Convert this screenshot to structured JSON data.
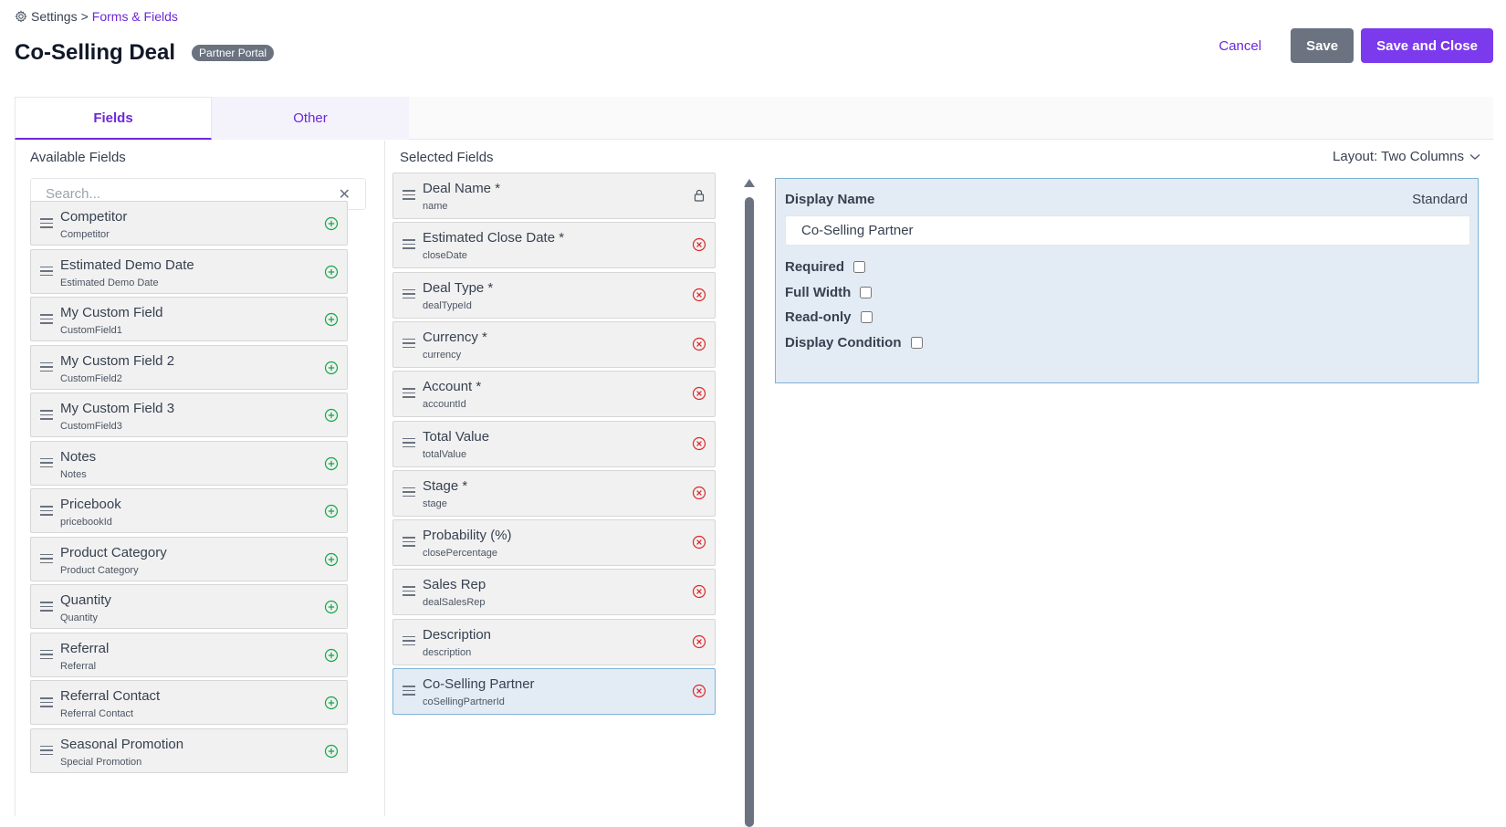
{
  "breadcrumb": {
    "root": "Settings",
    "separator": ">",
    "current": "Forms & Fields"
  },
  "header": {
    "title": "Co-Selling Deal",
    "badge": "Partner Portal"
  },
  "actions": {
    "cancel": "Cancel",
    "save": "Save",
    "save_close": "Save and Close"
  },
  "tabs": [
    {
      "label": "Fields",
      "active": true
    },
    {
      "label": "Other",
      "active": false
    }
  ],
  "available": {
    "title": "Available Fields",
    "search_placeholder": "Search...",
    "items": [
      {
        "label": "Competitor",
        "key": "Competitor"
      },
      {
        "label": "Estimated Demo Date",
        "key": "Estimated Demo Date"
      },
      {
        "label": "My Custom Field",
        "key": "CustomField1"
      },
      {
        "label": "My Custom Field 2",
        "key": "CustomField2"
      },
      {
        "label": "My Custom Field 3",
        "key": "CustomField3"
      },
      {
        "label": "Notes",
        "key": "Notes"
      },
      {
        "label": "Pricebook",
        "key": "pricebookId"
      },
      {
        "label": "Product Category",
        "key": "Product Category"
      },
      {
        "label": "Quantity",
        "key": "Quantity"
      },
      {
        "label": "Referral",
        "key": "Referral"
      },
      {
        "label": "Referral Contact",
        "key": "Referral Contact"
      },
      {
        "label": "Seasonal Promotion",
        "key": "Special Promotion"
      }
    ]
  },
  "selected": {
    "title": "Selected Fields",
    "layout": "Layout: Two Columns",
    "items": [
      {
        "label": "Deal Name *",
        "key": "name",
        "icon": "lock-icon"
      },
      {
        "label": "Estimated Close Date *",
        "key": "closeDate",
        "icon": "remove-icon"
      },
      {
        "label": "Deal Type *",
        "key": "dealTypeId",
        "icon": "remove-icon"
      },
      {
        "label": "Currency *",
        "key": "currency",
        "icon": "remove-icon"
      },
      {
        "label": "Account *",
        "key": "accountId",
        "icon": "remove-icon"
      },
      {
        "label": "Total Value",
        "key": "totalValue",
        "icon": "remove-icon"
      },
      {
        "label": "Stage *",
        "key": "stage",
        "icon": "remove-icon"
      },
      {
        "label": "Probability (%)",
        "key": "closePercentage",
        "icon": "remove-icon"
      },
      {
        "label": "Sales Rep",
        "key": "dealSalesRep",
        "icon": "remove-icon"
      },
      {
        "label": "Description",
        "key": "description",
        "icon": "remove-icon"
      },
      {
        "label": "Co-Selling Partner",
        "key": "coSellingPartnerId",
        "icon": "remove-icon",
        "selected": true
      }
    ]
  },
  "properties": {
    "header": "Display Name",
    "type": "Standard",
    "display_name_value": "Co-Selling Partner",
    "checkboxes": [
      {
        "label": "Required",
        "checked": false
      },
      {
        "label": "Full Width",
        "checked": false
      },
      {
        "label": "Read-only",
        "checked": false
      },
      {
        "label": "Display Condition",
        "checked": false
      }
    ]
  },
  "colors": {
    "accent": "#7c3aed",
    "link": "#6d28d9",
    "add": "#16a34a",
    "remove": "#dc2626",
    "selected_bg": "#e3ecf4"
  }
}
